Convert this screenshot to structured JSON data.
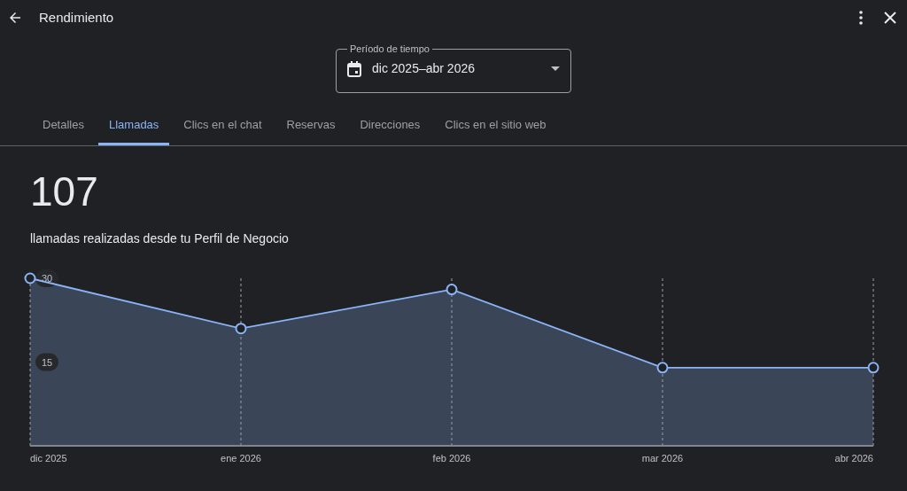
{
  "header": {
    "title": "Rendimiento"
  },
  "period_select": {
    "label": "Período de tiempo",
    "value": "dic 2025–abr 2026"
  },
  "tabs": [
    {
      "label": "Detalles",
      "selected": false
    },
    {
      "label": "Llamadas",
      "selected": true
    },
    {
      "label": "Clics en el chat",
      "selected": false
    },
    {
      "label": "Reservas",
      "selected": false
    },
    {
      "label": "Direcciones",
      "selected": false
    },
    {
      "label": "Clics en el sitio web",
      "selected": false
    }
  ],
  "summary": {
    "total": "107",
    "caption": "llamadas realizadas desde tu Perfil de Negocio"
  },
  "chart": {
    "chart_data": {
      "type": "area",
      "categories": [
        "dic 2025",
        "ene 2026",
        "feb 2026",
        "mar 2026",
        "abr 2026"
      ],
      "series": [
        {
          "color": "#8ab4f8",
          "values": [
            30,
            21,
            28,
            14,
            14
          ]
        }
      ],
      "ylim": [
        0,
        30
      ],
      "yticks": [
        15,
        30
      ],
      "grid": true
    }
  }
}
